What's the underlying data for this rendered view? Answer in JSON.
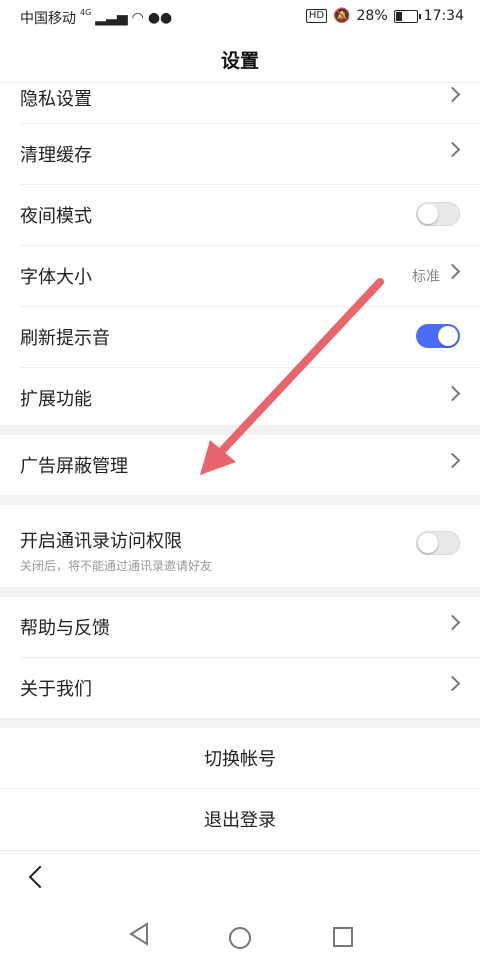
{
  "status_bar": {
    "carrier": "中国移动",
    "network": "4G",
    "battery": "28%",
    "battery_level": 0.28,
    "time": "17:34",
    "hd": "HD"
  },
  "header": {
    "title": "设置"
  },
  "settings": {
    "privacy": {
      "label": "隐私设置"
    },
    "clear_cache": {
      "label": "清理缓存"
    },
    "night_mode": {
      "label": "夜间模式",
      "enabled": false
    },
    "font_size": {
      "label": "字体大小",
      "value": "标准"
    },
    "refresh_sound": {
      "label": "刷新提示音",
      "enabled": true
    },
    "extensions": {
      "label": "扩展功能"
    },
    "ad_block": {
      "label": "广告屏蔽管理"
    },
    "contacts_permission": {
      "label": "开启通讯录访问权限",
      "sub": "关闭后，将不能通过通讯录邀请好友",
      "enabled": false
    },
    "help": {
      "label": "帮助与反馈"
    },
    "about": {
      "label": "关于我们"
    }
  },
  "account": {
    "switch": "切换帐号",
    "logout": "退出登录"
  },
  "colors": {
    "toggle_on": "#4a6cf7",
    "annotation_arrow": "#e8656c"
  }
}
